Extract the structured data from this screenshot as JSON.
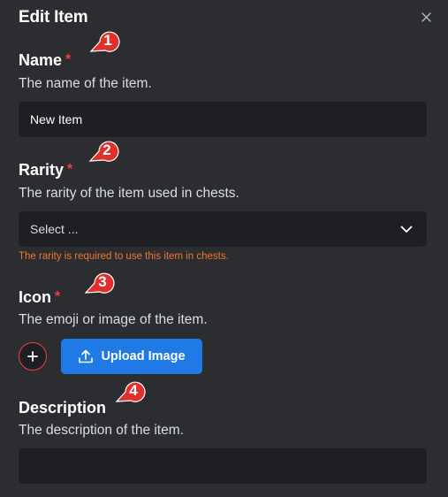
{
  "dialog": {
    "title": "Edit Item",
    "close_icon": "close-icon"
  },
  "fields": {
    "name": {
      "label": "Name",
      "required_mark": "*",
      "description": "The name of the item.",
      "value": "New Item"
    },
    "rarity": {
      "label": "Rarity",
      "required_mark": "*",
      "description": "The rarity of the item used in chests.",
      "selected": "Select ...",
      "error": "The rarity is required to use this item in chests."
    },
    "icon": {
      "label": "Icon",
      "required_mark": "*",
      "description": "The emoji or image of the item.",
      "add_icon": "plus-icon",
      "upload_label": "Upload Image",
      "upload_icon": "upload-icon"
    },
    "description": {
      "label": "Description",
      "description": "The description of the item.",
      "value": ""
    }
  },
  "annotations": [
    "1",
    "2",
    "3",
    "4"
  ],
  "colors": {
    "background": "#2b2d31",
    "input": "#1e1f22",
    "required": "#f23f43",
    "error": "#f0762d",
    "primary": "#1f7ae6",
    "badge": "#e0302b"
  }
}
